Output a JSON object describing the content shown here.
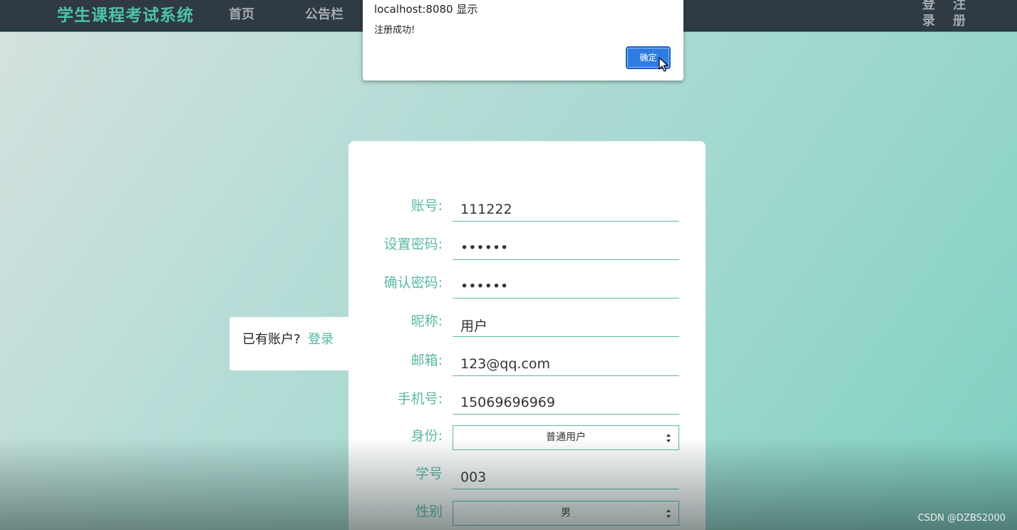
{
  "navbar": {
    "brand": "学生课程考试系统",
    "links": [
      "首页",
      "公告栏"
    ],
    "auth": {
      "login": "登录",
      "register": "注册"
    }
  },
  "alert": {
    "origin": "localhost:8080 显示",
    "message": "注册成功!",
    "ok_label": "确定"
  },
  "login_hint": {
    "text": "已有账户?",
    "link": "登录"
  },
  "form": {
    "account": {
      "label": "账号:",
      "value": "111222"
    },
    "password": {
      "label": "设置密码:",
      "value": "••••••"
    },
    "confirm_password": {
      "label": "确认密码:",
      "value": "••••••"
    },
    "nickname": {
      "label": "昵称:",
      "value": "用户"
    },
    "email": {
      "label": "邮箱:",
      "value": "123@qq.com"
    },
    "phone": {
      "label": "手机号:",
      "value": "15069696969"
    },
    "identity": {
      "label": "身份:",
      "value": "普通用户"
    },
    "student_id": {
      "label": "学号",
      "value": "003"
    },
    "gender": {
      "label": "性别",
      "value": "男"
    }
  },
  "watermark": "CSDN @DZBS2000",
  "colors": {
    "accent": "#5bb8a8",
    "navbar": "#2f3a43",
    "brand": "#4dc3a9",
    "dialog_button": "#2f7de1"
  }
}
